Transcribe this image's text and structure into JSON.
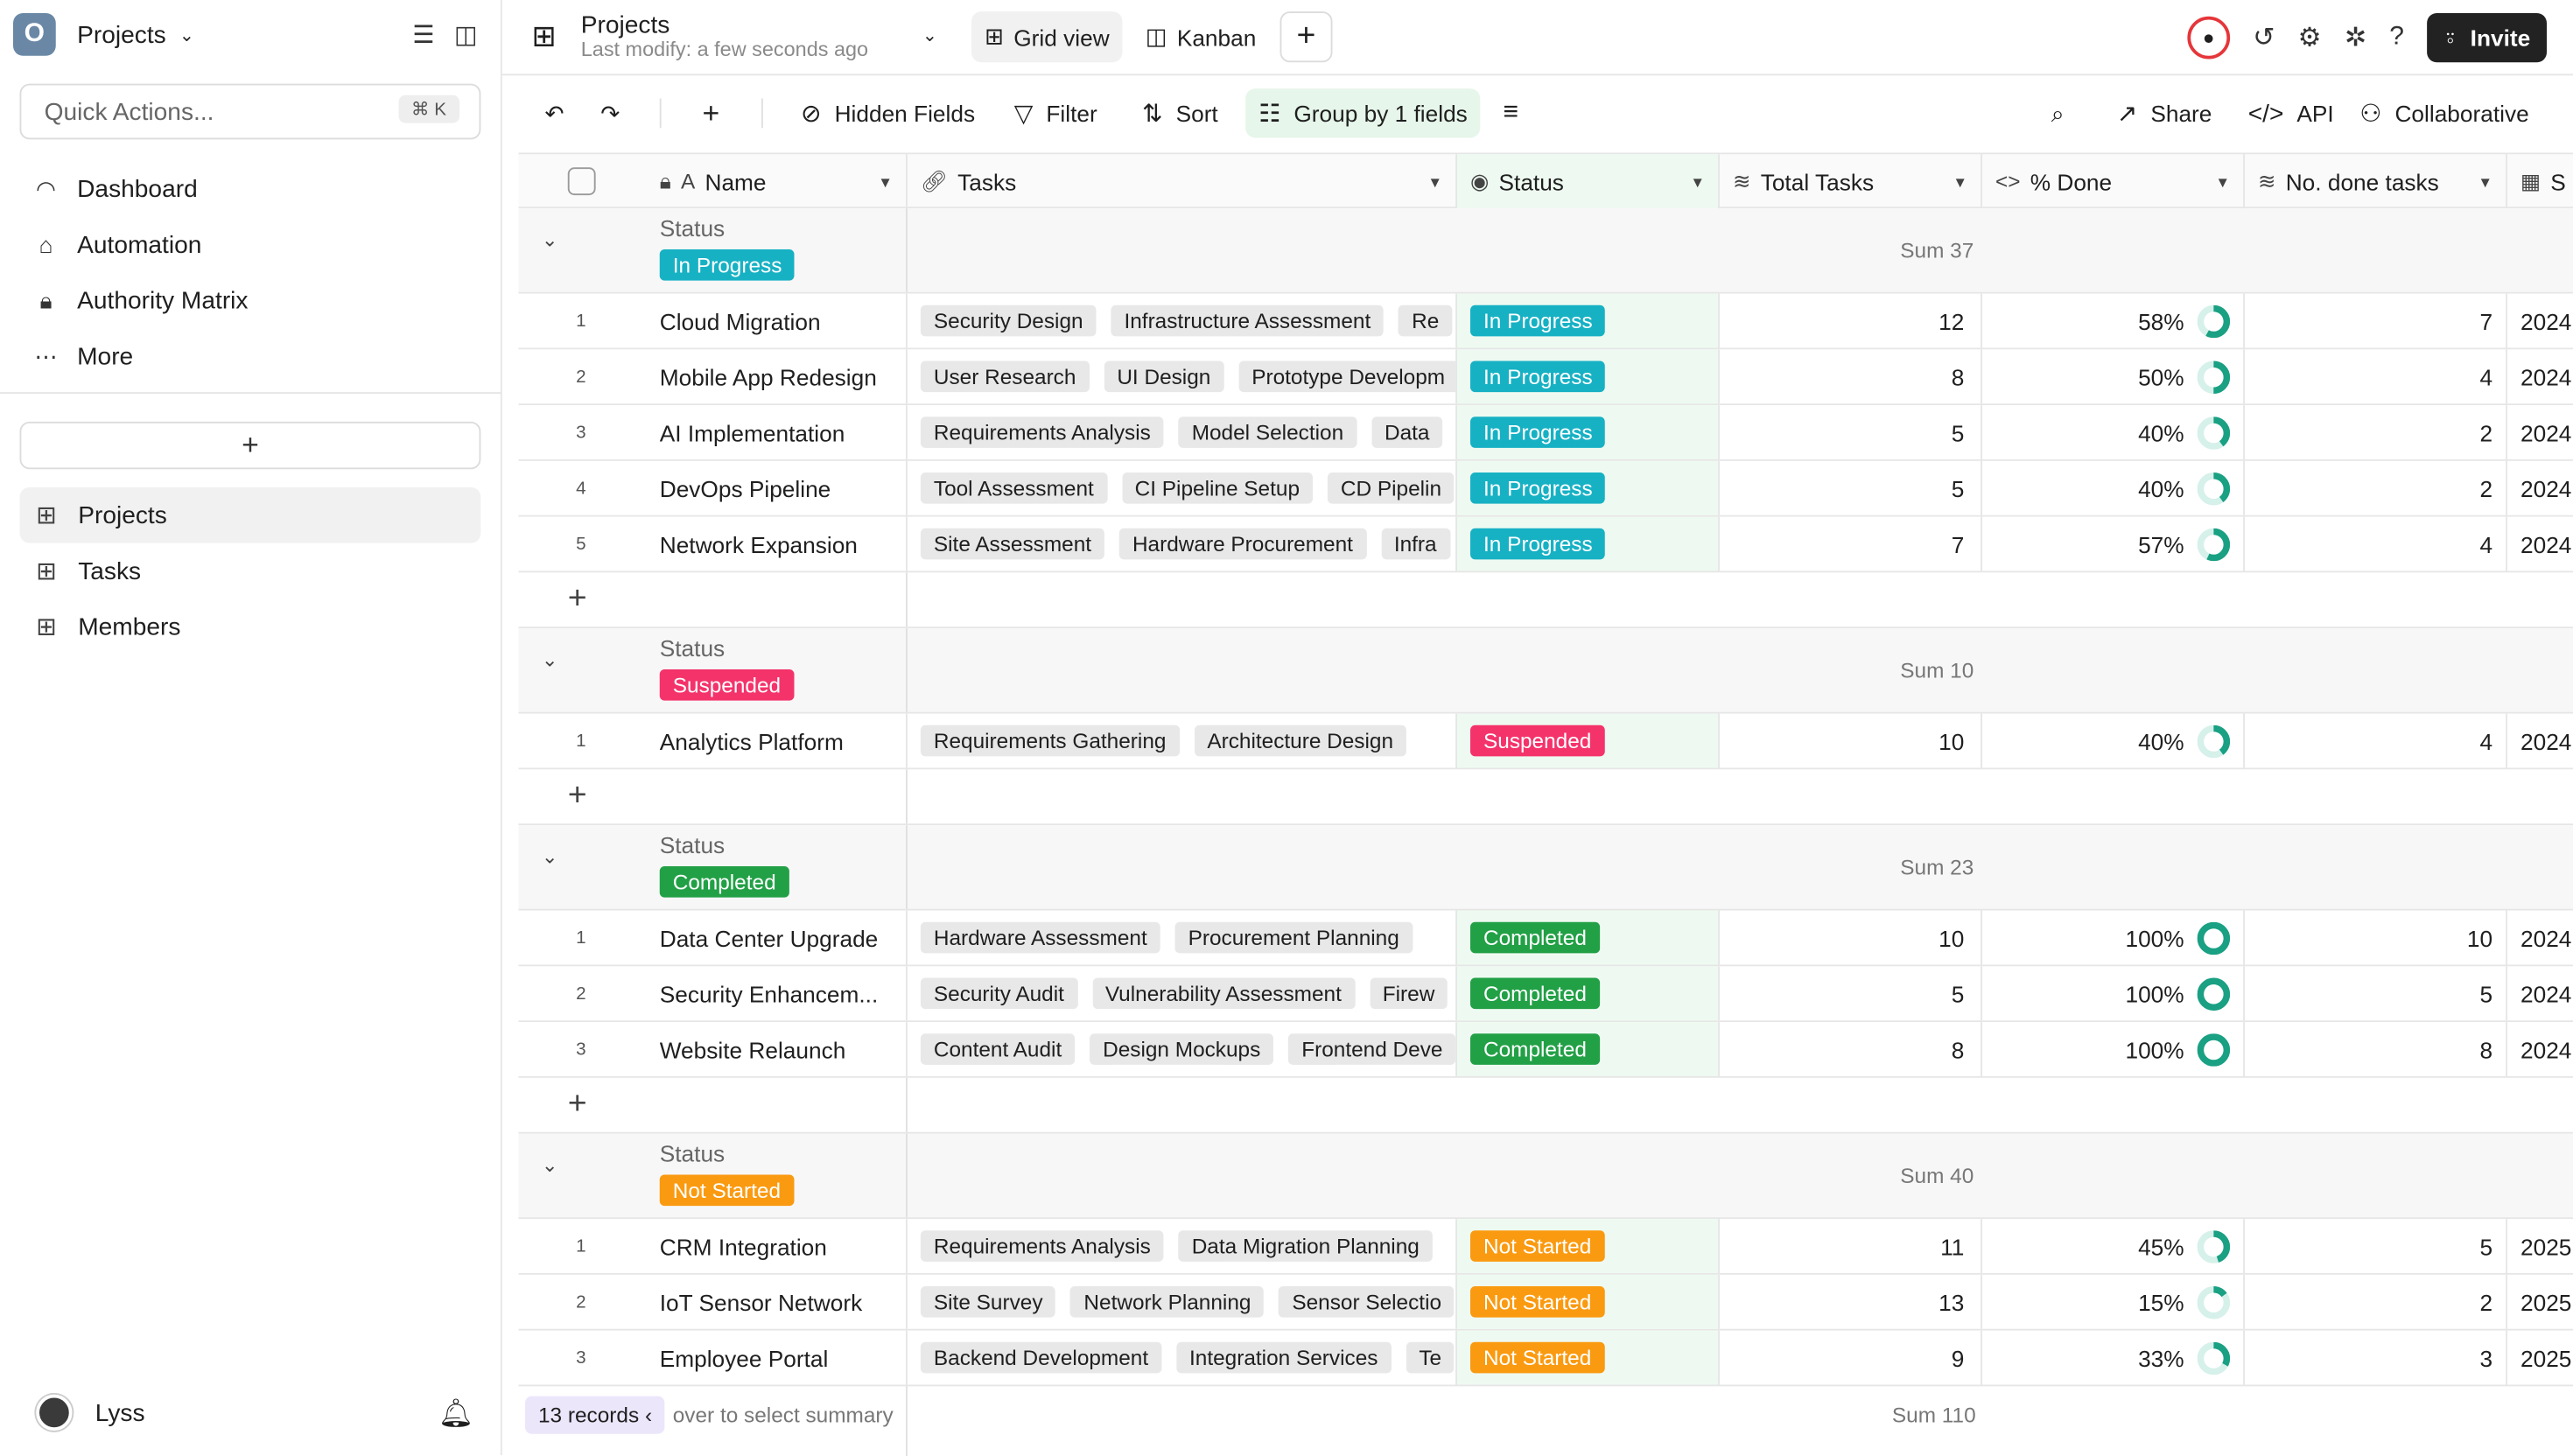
{
  "sidebar": {
    "workspace_initial": "O",
    "workspace_name": "Projects",
    "quick_actions_placeholder": "Quick Actions...",
    "quick_actions_shortcut": "⌘ K",
    "nav": [
      "Dashboard",
      "Automation",
      "Authority Matrix",
      "More"
    ],
    "add_label": "+",
    "tables": [
      "Projects",
      "Tasks",
      "Members"
    ],
    "user_name": "Lyss"
  },
  "topbar": {
    "title": "Projects",
    "subtitle": "Last modify: a few seconds ago",
    "view_grid": "Grid view",
    "view_kanban": "Kanban",
    "invite": "Invite"
  },
  "toolbar": {
    "hidden_fields": "Hidden Fields",
    "filter": "Filter",
    "sort": "Sort",
    "group": "Group by 1 fields",
    "share": "Share",
    "api": "API",
    "collaborative": "Collaborative"
  },
  "columns": [
    "Name",
    "Tasks",
    "Status",
    "Total Tasks",
    "% Done",
    "No. done tasks",
    "S"
  ],
  "colors": {
    "In Progress": "#17b1c4",
    "Suspended": "#f4336b",
    "Completed": "#22a046",
    "Not Started": "#fa9a10",
    "ring": "#1aa083",
    "ring_bg": "#d6f0ea"
  },
  "groups": [
    {
      "label": "Status",
      "status": "In Progress",
      "sum": "Sum 37",
      "rows": [
        {
          "n": "1",
          "name": "Cloud Migration",
          "tasks": [
            "Security Design",
            "Infrastructure Assessment",
            "Re"
          ],
          "status": "In Progress",
          "total": "12",
          "pct": "58%",
          "frac": 0.58,
          "done": "7",
          "date": "2024"
        },
        {
          "n": "2",
          "name": "Mobile App Redesign",
          "tasks": [
            "User Research",
            "UI Design",
            "Prototype Developm"
          ],
          "status": "In Progress",
          "total": "8",
          "pct": "50%",
          "frac": 0.5,
          "done": "4",
          "date": "2024"
        },
        {
          "n": "3",
          "name": "AI Implementation",
          "tasks": [
            "Requirements Analysis",
            "Model Selection",
            "Data"
          ],
          "status": "In Progress",
          "total": "5",
          "pct": "40%",
          "frac": 0.4,
          "done": "2",
          "date": "2024"
        },
        {
          "n": "4",
          "name": "DevOps Pipeline",
          "tasks": [
            "Tool Assessment",
            "CI Pipeline Setup",
            "CD Pipelin"
          ],
          "status": "In Progress",
          "total": "5",
          "pct": "40%",
          "frac": 0.4,
          "done": "2",
          "date": "2024"
        },
        {
          "n": "5",
          "name": "Network Expansion",
          "tasks": [
            "Site Assessment",
            "Hardware Procurement",
            "Infra"
          ],
          "status": "In Progress",
          "total": "7",
          "pct": "57%",
          "frac": 0.57,
          "done": "4",
          "date": "2024"
        }
      ]
    },
    {
      "label": "Status",
      "status": "Suspended",
      "sum": "Sum 10",
      "rows": [
        {
          "n": "1",
          "name": "Analytics Platform",
          "tasks": [
            "Requirements Gathering",
            "Architecture Design"
          ],
          "status": "Suspended",
          "total": "10",
          "pct": "40%",
          "frac": 0.4,
          "done": "4",
          "date": "2024"
        }
      ]
    },
    {
      "label": "Status",
      "status": "Completed",
      "sum": "Sum 23",
      "rows": [
        {
          "n": "1",
          "name": "Data Center Upgrade",
          "tasks": [
            "Hardware Assessment",
            "Procurement Planning"
          ],
          "status": "Completed",
          "total": "10",
          "pct": "100%",
          "frac": 1.0,
          "done": "10",
          "date": "2024"
        },
        {
          "n": "2",
          "name": "Security Enhancem...",
          "tasks": [
            "Security Audit",
            "Vulnerability Assessment",
            "Firew"
          ],
          "status": "Completed",
          "total": "5",
          "pct": "100%",
          "frac": 1.0,
          "done": "5",
          "date": "2024"
        },
        {
          "n": "3",
          "name": "Website Relaunch",
          "tasks": [
            "Content Audit",
            "Design Mockups",
            "Frontend Deve"
          ],
          "status": "Completed",
          "total": "8",
          "pct": "100%",
          "frac": 1.0,
          "done": "8",
          "date": "2024"
        }
      ]
    },
    {
      "label": "Status",
      "status": "Not Started",
      "sum": "Sum 40",
      "rows": [
        {
          "n": "1",
          "name": "CRM Integration",
          "tasks": [
            "Requirements Analysis",
            "Data Migration Planning"
          ],
          "status": "Not Started",
          "total": "11",
          "pct": "45%",
          "frac": 0.45,
          "done": "5",
          "date": "2025"
        },
        {
          "n": "2",
          "name": "IoT Sensor Network",
          "tasks": [
            "Site Survey",
            "Network Planning",
            "Sensor Selectio"
          ],
          "status": "Not Started",
          "total": "13",
          "pct": "15%",
          "frac": 0.15,
          "done": "2",
          "date": "2025"
        },
        {
          "n": "3",
          "name": "Employee Portal",
          "tasks": [
            "Backend Development",
            "Integration Services",
            "Te"
          ],
          "status": "Not Started",
          "total": "9",
          "pct": "33%",
          "frac": 0.33,
          "done": "3",
          "date": "2025"
        }
      ]
    }
  ],
  "footer": {
    "records": "13 records",
    "hint": "over to select summary",
    "sum": "Sum 110"
  }
}
